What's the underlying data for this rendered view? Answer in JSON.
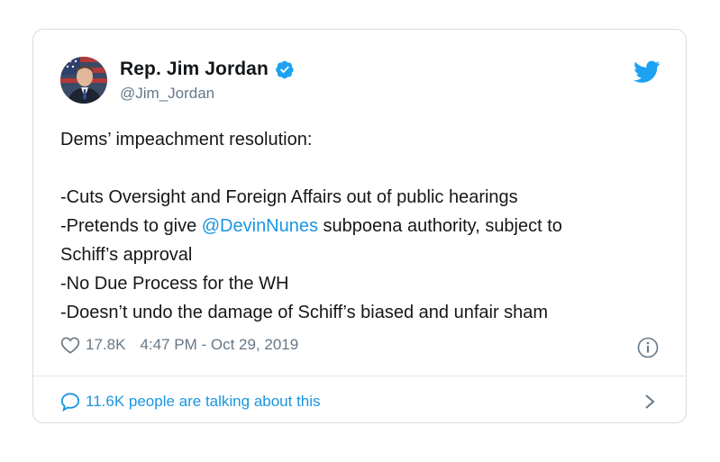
{
  "author": {
    "display_name": "Rep. Jim Jordan",
    "handle": "@Jim_Jordan",
    "verified": true
  },
  "tweet": {
    "line_1": "Dems’ impeachment resolution:",
    "line_2": "-Cuts Oversight and Foreign Affairs out of public hearings",
    "line_3_before": "-Pretends to give ",
    "line_3_mention": "@DevinNunes",
    "line_3_after": " subpoena authority, subject to",
    "line_4": "Schiff’s approval",
    "line_5": "-No Due Process for the WH",
    "line_6": "-Doesn’t undo the damage of Schiff’s biased and unfair sham"
  },
  "meta": {
    "like_count": "17.8K",
    "timestamp": "4:47 PM - Oct 29, 2019"
  },
  "footer": {
    "talking_text": "11.6K people are talking about this"
  },
  "colors": {
    "accent": "#1b95e0",
    "verified": "#1da1f2",
    "muted": "#657786",
    "border": "#d6dde3"
  },
  "icons": {
    "bird": "twitter-bird-icon",
    "verified": "verified-badge-icon",
    "like": "heart-icon",
    "info": "info-icon",
    "reply": "speech-bubble-icon",
    "chevron": "chevron-right-icon"
  }
}
